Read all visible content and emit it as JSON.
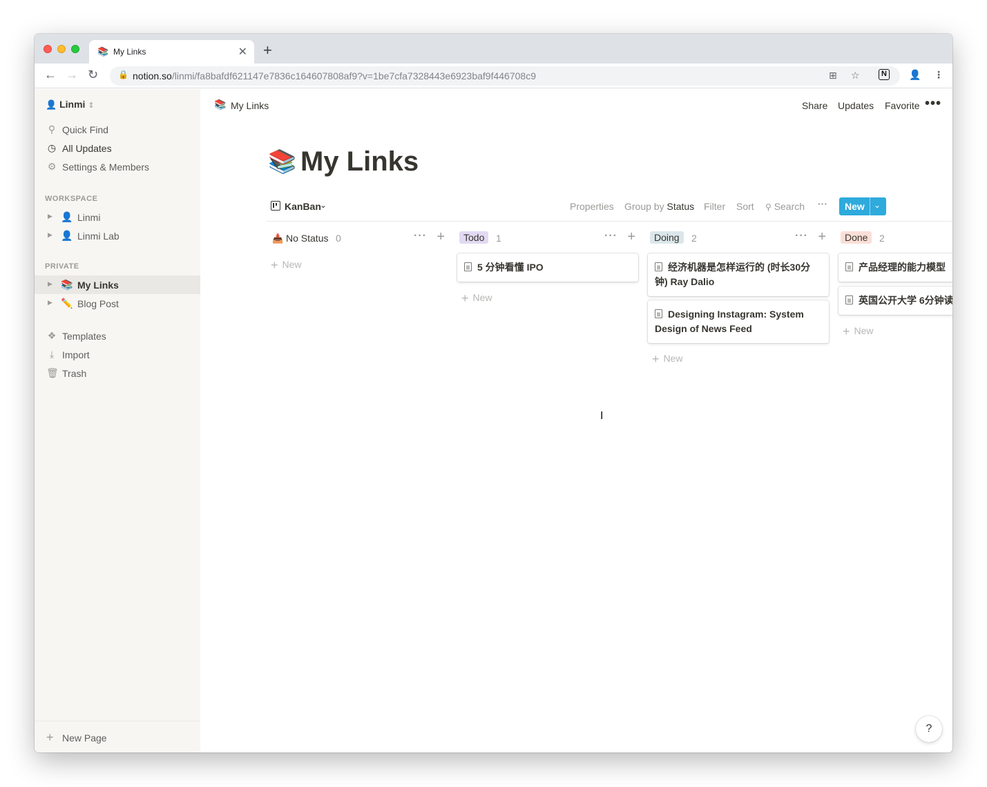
{
  "browser": {
    "tab_title": "My Links",
    "tab_favicon": "📚",
    "url_host": "notion.so",
    "url_path": "/linmi/fa8bafdf621147e7836c164607808af9?v=1be7cfa7328443e6923baf9f446708c9"
  },
  "sidebar": {
    "workspace": "Linmi",
    "nav": [
      {
        "label": "Quick Find",
        "icon": "search-icon"
      },
      {
        "label": "All Updates",
        "icon": "clock-icon"
      },
      {
        "label": "Settings & Members",
        "icon": "gear-icon"
      }
    ],
    "workspace_section": "WORKSPACE",
    "workspace_pages": [
      {
        "label": "Linmi",
        "icon": "avatar"
      },
      {
        "label": "Linmi Lab",
        "icon": "avatar"
      }
    ],
    "private_section": "PRIVATE",
    "private_pages": [
      {
        "label": "My Links",
        "emoji": "📚"
      },
      {
        "label": "Blog Post",
        "emoji": "✏️"
      }
    ],
    "tools": [
      {
        "label": "Templates",
        "icon": "templates-icon"
      },
      {
        "label": "Import",
        "icon": "download-icon"
      },
      {
        "label": "Trash",
        "icon": "trash-icon"
      }
    ],
    "new_page": "New Page"
  },
  "topbar": {
    "breadcrumb": "My Links",
    "breadcrumb_emoji": "📚",
    "share": "Share",
    "updates": "Updates",
    "favorite": "Favorite"
  },
  "page": {
    "emoji": "📚",
    "title": "My Links"
  },
  "view": {
    "name": "KanBan",
    "properties": "Properties",
    "group_by": "Group by",
    "group_field": "Status",
    "filter": "Filter",
    "sort": "Sort",
    "search": "Search",
    "new": "New"
  },
  "board": {
    "new_label": "New",
    "columns": [
      {
        "name": "No Status",
        "count": "0",
        "color": "",
        "cards": []
      },
      {
        "name": "Todo",
        "count": "1",
        "color": "#e2d9f3",
        "cards": [
          "5 分钟看懂 IPO"
        ]
      },
      {
        "name": "Doing",
        "count": "2",
        "color": "#dbe7ea",
        "cards": [
          "经济机器是怎样运行的 (时长30分钟) Ray Dalio",
          "Designing Instagram: System Design of News Feed"
        ]
      },
      {
        "name": "Done",
        "count": "2",
        "color": "#fadfd7",
        "cards": [
          "产品经理的能力模型",
          "英国公开大学 6分钟读"
        ]
      }
    ]
  },
  "help": "?"
}
